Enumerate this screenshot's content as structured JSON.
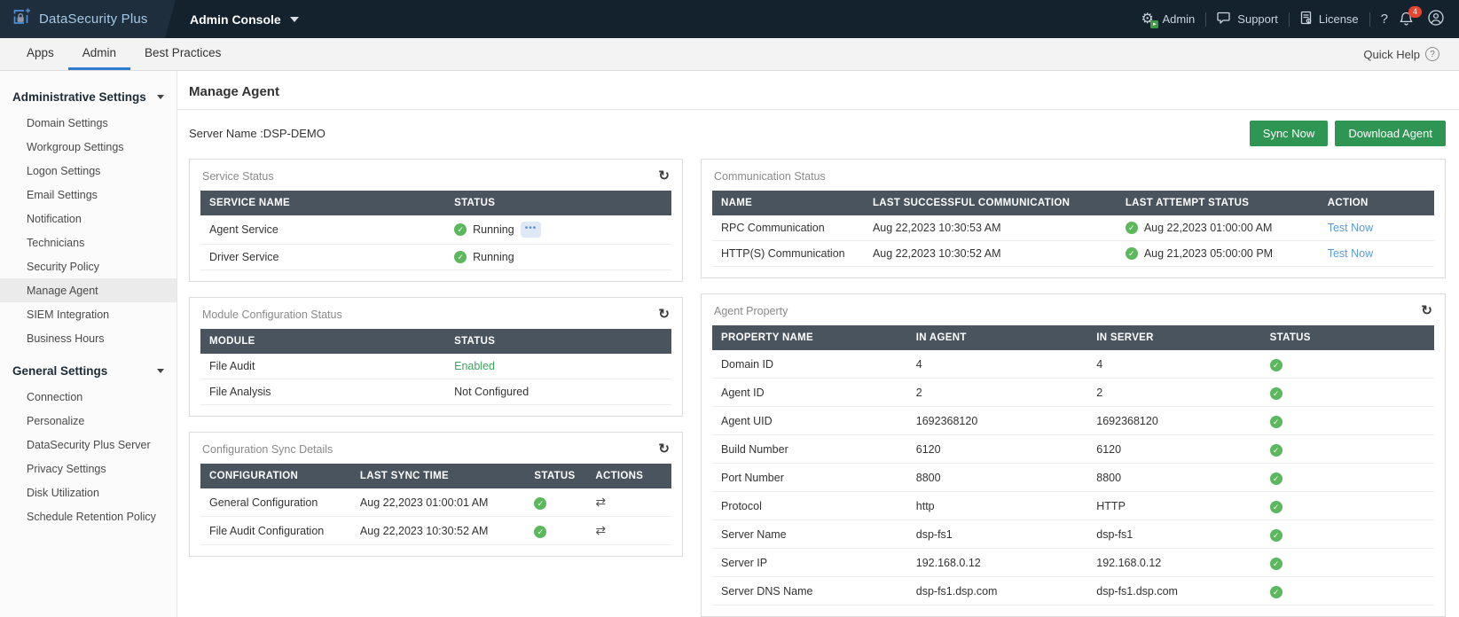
{
  "header": {
    "brand": "DataSecurity Plus",
    "console": "Admin Console",
    "admin": "Admin",
    "support": "Support",
    "license": "License",
    "help": "?",
    "badge": "4"
  },
  "tabs": {
    "apps": "Apps",
    "admin": "Admin",
    "best_practices": "Best Practices",
    "quick_help": "Quick Help"
  },
  "sidebar": {
    "admin_section": {
      "title": "Administrative Settings",
      "items": [
        "Domain Settings",
        "Workgroup Settings",
        "Logon Settings",
        "Email Settings",
        "Notification",
        "Technicians",
        "Security Policy",
        "Manage Agent",
        "SIEM Integration",
        "Business Hours"
      ]
    },
    "general_section": {
      "title": "General Settings",
      "items": [
        "Connection",
        "Personalize",
        "DataSecurity Plus Server",
        "Privacy Settings",
        "Disk Utilization",
        "Schedule Retention Policy"
      ]
    },
    "selected_item": "Manage Agent"
  },
  "main": {
    "title": "Manage Agent",
    "server_name": "Server Name :DSP-DEMO",
    "sync_btn": "Sync Now",
    "download_btn": "Download Agent",
    "service_status": {
      "title": "Service Status",
      "headers": [
        "SERVICE NAME",
        "STATUS"
      ],
      "rows": [
        {
          "name": "Agent Service",
          "status": "Running",
          "more": "..."
        },
        {
          "name": "Driver Service",
          "status": "Running"
        }
      ]
    },
    "module_status": {
      "title": "Module Configuration Status",
      "headers": [
        "MODULE",
        "STATUS"
      ],
      "rows": [
        {
          "name": "File Audit",
          "status": "Enabled"
        },
        {
          "name": "File Analysis",
          "status": "Not Configured"
        }
      ]
    },
    "config_sync": {
      "title": "Configuration Sync Details",
      "headers": [
        "CONFIGURATION",
        "LAST SYNC TIME",
        "STATUS",
        "ACTIONS"
      ],
      "rows": [
        {
          "name": "General Configuration",
          "time": "Aug 22,2023 01:00:01 AM"
        },
        {
          "name": "File Audit Configuration",
          "time": "Aug 22,2023 10:30:52 AM"
        }
      ]
    },
    "communication": {
      "title": "Communication Status",
      "headers": [
        "NAME",
        "LAST SUCCESSFUL COMMUNICATION",
        "LAST ATTEMPT STATUS",
        "ACTION"
      ],
      "rows": [
        {
          "name": "RPC Communication",
          "last_success": "Aug 22,2023 10:30:53 AM",
          "last_attempt": "Aug 22,2023 01:00:00 AM",
          "action": "Test Now"
        },
        {
          "name": "HTTP(S) Communication",
          "last_success": "Aug 22,2023 10:30:52 AM",
          "last_attempt": "Aug 21,2023 05:00:00 PM",
          "action": "Test Now"
        }
      ]
    },
    "agent_property": {
      "title": "Agent Property",
      "headers": [
        "PROPERTY NAME",
        "IN AGENT",
        "IN SERVER",
        "STATUS"
      ],
      "rows": [
        {
          "name": "Domain ID",
          "agent": "4",
          "server": "4"
        },
        {
          "name": "Agent ID",
          "agent": "2",
          "server": "2"
        },
        {
          "name": "Agent UID",
          "agent": "1692368120",
          "server": "1692368120"
        },
        {
          "name": "Build Number",
          "agent": "6120",
          "server": "6120"
        },
        {
          "name": "Port Number",
          "agent": "8800",
          "server": "8800"
        },
        {
          "name": "Protocol",
          "agent": "http",
          "server": "HTTP"
        },
        {
          "name": "Server Name",
          "agent": "dsp-fs1",
          "server": "dsp-fs1"
        },
        {
          "name": "Server IP",
          "agent": "192.168.0.12",
          "server": "192.168.0.12"
        },
        {
          "name": "Server DNS Name",
          "agent": "dsp-fs1.dsp.com",
          "server": "dsp-fs1.dsp.com"
        }
      ]
    }
  },
  "colors": {
    "header_dark": "#14222e",
    "header_logo_zone": "#1e2e3c",
    "tab_active_underline": "#2f7cd0",
    "table_header": "#49545f",
    "button_green": "#2e9553",
    "success_green": "#5cb85c",
    "link_blue": "#5b9bd5"
  }
}
